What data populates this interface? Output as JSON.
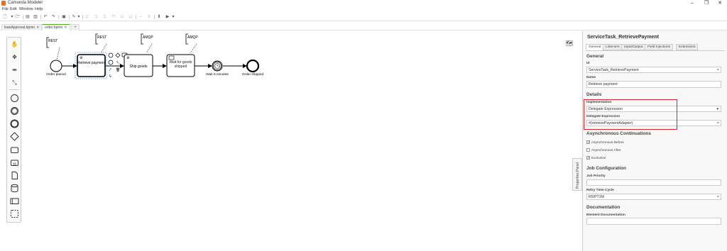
{
  "window": {
    "title": "Camunda Modeler",
    "controls": {
      "minimize": "–",
      "maximize": "❐",
      "close": "✕"
    }
  },
  "menu": [
    "File",
    "Edit",
    "Window",
    "Help"
  ],
  "tabs": [
    {
      "label": "loanApproval.bpmn",
      "active": false
    },
    {
      "label": "order.bpmn",
      "active": true
    }
  ],
  "tab_add_label": "+",
  "diagram": {
    "start_event_label": "Order placed",
    "task_retrieve": "Retrieve payment",
    "task_ship": "Ship goods",
    "task_wait": "Wait for goods shipped",
    "timer_label": "Wait 5 minutes",
    "end_event_label": "Order shipped",
    "annotations": [
      "REST",
      "REST",
      "AMQP",
      "AMQP"
    ]
  },
  "side_panel_toggle": "Properties Panel",
  "properties": {
    "element_id_title": "ServiceTask_RetrievePayment",
    "tabs": [
      "General",
      "Listeners",
      "Input/Output",
      "Field Injections",
      "Extensions"
    ],
    "active_tab": "General",
    "sections": {
      "general": "General",
      "details": "Details",
      "async": "Asynchronous Continuations",
      "job": "Job Configuration",
      "documentation": "Documentation"
    },
    "fields": {
      "id_label": "Id",
      "id_value": "ServiceTask_RetrievePayment",
      "name_label": "Name",
      "name_value": "Retrieve payment",
      "implementation_label": "Implementation",
      "implementation_value": "Delegate Expression",
      "delegate_label": "Delegate Expression",
      "delegate_value": "#{retrievePaymentAdapter}",
      "async_before": "Asynchronous Before",
      "async_after": "Asynchronous After",
      "exclusive": "Exclusive",
      "job_priority_label": "Job Priority",
      "job_priority_value": "",
      "retry_label": "Retry Time Cycle",
      "retry_value": "R5/PT1M",
      "element_doc_label": "Element Documentation",
      "element_doc_value": ""
    },
    "checks": {
      "async_before": true,
      "async_after": false,
      "exclusive": true
    }
  },
  "colors": {
    "accent": "#52b415",
    "highlight": "#d6252e",
    "brand": "#f36b21"
  }
}
